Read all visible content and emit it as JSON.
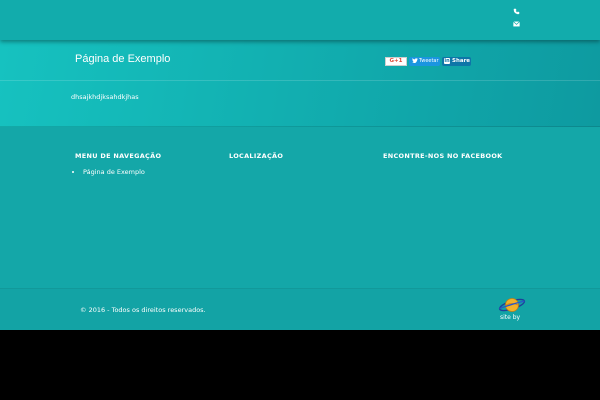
{
  "header": {
    "icons": [
      "phone-icon",
      "mail-icon"
    ]
  },
  "hero": {
    "title": "Página de Exemplo",
    "text": "dhsajkhdjksahdkjhas",
    "share": {
      "gplus_label": "G+1",
      "tweet_label": "Tweetar",
      "linkedin_mark": "in",
      "linkedin_label": "Share"
    }
  },
  "footer": {
    "columns": [
      {
        "title": "MENU DE NAVEGAÇÃO",
        "items": [
          "Página de Exemplo"
        ]
      },
      {
        "title": "LOCALIZAÇÃO"
      },
      {
        "title": "ENCONTRE-NOS NO FACEBOOK"
      }
    ]
  },
  "bottom": {
    "copyright": "© 2016 - Todos os direitos reservados.",
    "site_by": "site by"
  },
  "colors": {
    "primary": "#14a7a8",
    "header": "#12acac",
    "twitter": "#1b95e0",
    "linkedin": "#0e76a8",
    "gplus": "#dd4b39"
  }
}
